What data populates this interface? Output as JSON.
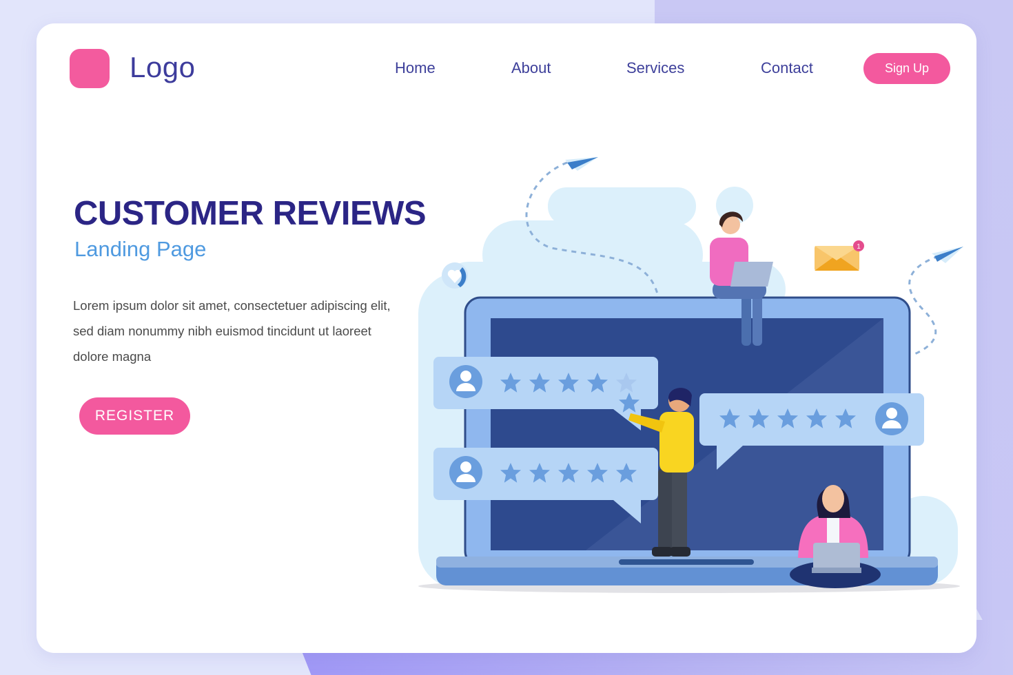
{
  "brand": {
    "logo_text": "Logo",
    "logo_color": "#f35b9e"
  },
  "nav": {
    "items": [
      {
        "label": "Home"
      },
      {
        "label": "About"
      },
      {
        "label": "Services"
      },
      {
        "label": "Contact"
      }
    ],
    "signup_label": "Sign Up"
  },
  "hero": {
    "title": "CUSTOMER REVIEWS",
    "subtitle": "Landing Page",
    "body_lines": [
      "Lorem ipsum dolor sit amet, consectetuer adipiscing elit,",
      "sed diam nonummy nibh euismod tincidunt ut laoreet",
      "dolore magna"
    ],
    "register_label": "REGISTER"
  },
  "illustration": {
    "reviews": [
      {
        "rating": 4,
        "max": 5,
        "avatar": "user-icon"
      },
      {
        "rating": 5,
        "max": 5,
        "avatar": "user-icon"
      },
      {
        "rating": 5,
        "max": 5,
        "avatar": "user-icon"
      }
    ],
    "mail_badge_count": "1",
    "icons": [
      "paper-plane-icon",
      "heart-icon",
      "envelope-icon",
      "star-icon"
    ]
  },
  "colors": {
    "accent_pink": "#f3599e",
    "title_navy": "#2b2585",
    "subtitle_blue": "#4f9ae0",
    "nav_text": "#3d3f9a",
    "laptop_screen": "#2e4a8e",
    "laptop_frame": "#8fb7ee",
    "bubble": "#b6d5f6",
    "star": "#6a9ede"
  }
}
